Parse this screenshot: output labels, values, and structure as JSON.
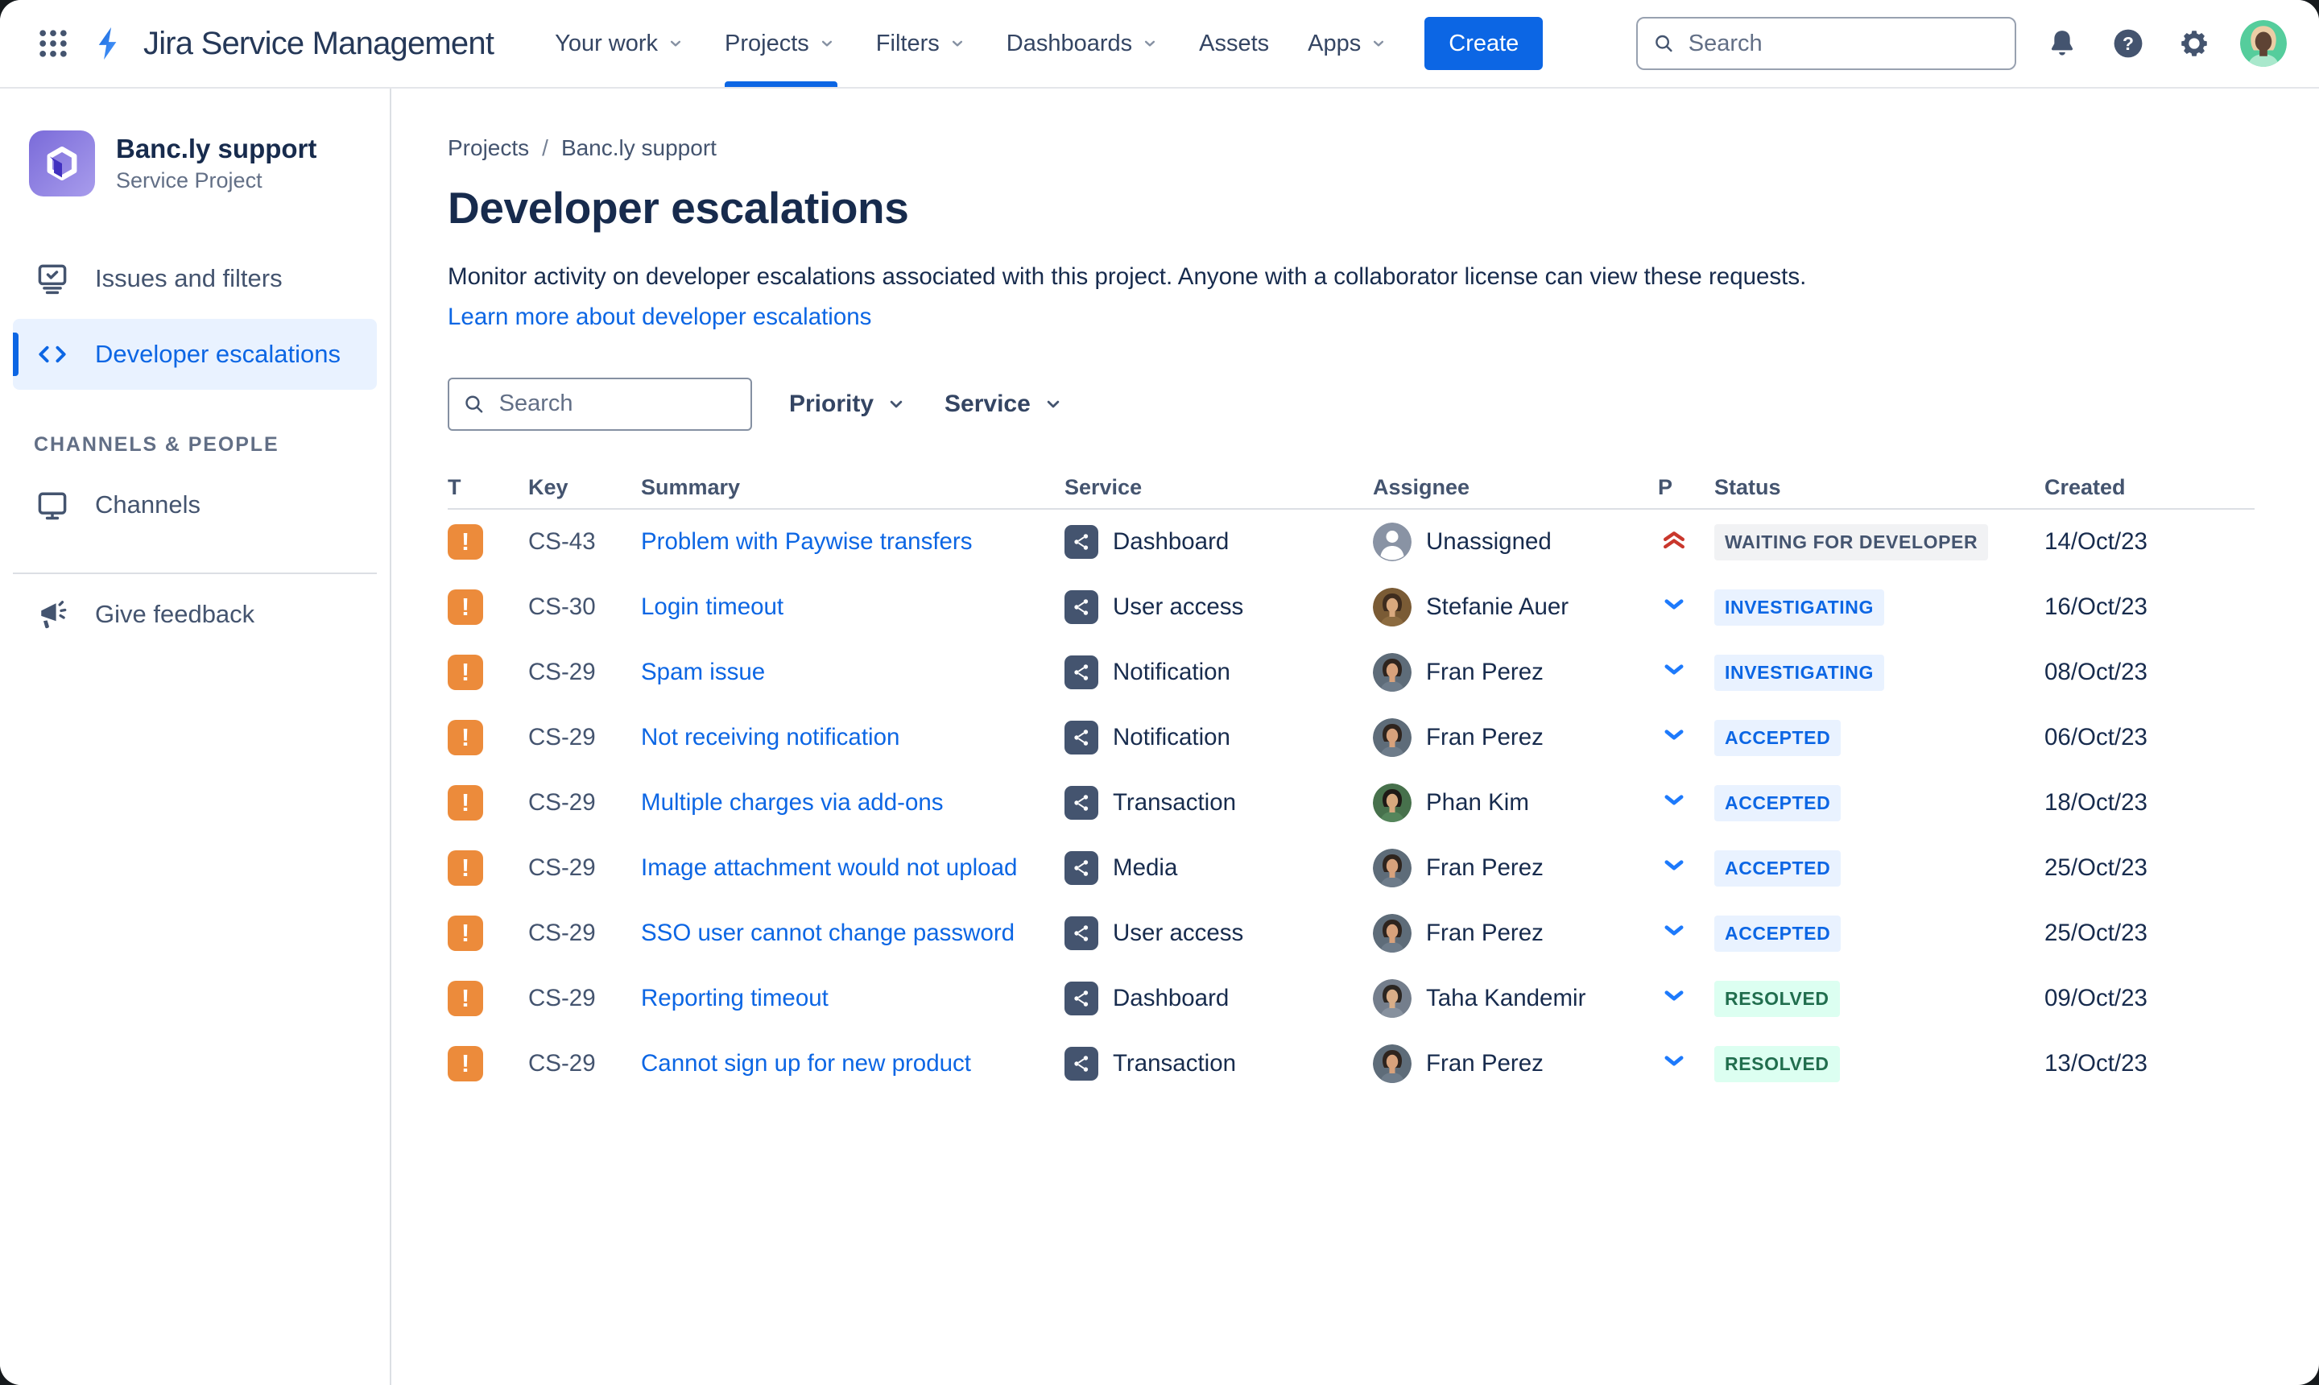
{
  "header": {
    "app_name": "Jira Service Management",
    "nav": [
      {
        "label": "Your work"
      },
      {
        "label": "Projects"
      },
      {
        "label": "Filters"
      },
      {
        "label": "Dashboards"
      },
      {
        "label": "Assets"
      },
      {
        "label": "Apps"
      }
    ],
    "create_label": "Create",
    "search_placeholder": "Search",
    "user_avatar": {
      "bg": "#55CD9C",
      "hair": "#EBCDA5",
      "skin": "#5E4334",
      "shirt": "#A9E8CC"
    }
  },
  "sidebar": {
    "project_name": "Banc.ly support",
    "project_type": "Service Project",
    "items": [
      {
        "label": "Issues and filters",
        "active": false
      },
      {
        "label": "Developer escalations",
        "active": true
      }
    ],
    "section_label": "CHANNELS & PEOPLE",
    "channels_label": "Channels",
    "feedback_label": "Give feedback"
  },
  "main": {
    "breadcrumb": [
      "Projects",
      "Banc.ly support"
    ],
    "breadcrumb_separator": "/",
    "title": "Developer escalations",
    "description": "Monitor activity on developer escalations associated with this project. Anyone with a collaborator license can view these requests.",
    "learn_more": "Learn more about developer escalations",
    "filters": {
      "search_placeholder": "Search",
      "priority_label": "Priority",
      "service_label": "Service"
    },
    "table": {
      "columns": [
        "T",
        "Key",
        "Summary",
        "Service",
        "Assignee",
        "P",
        "Status",
        "Created"
      ],
      "rows": [
        {
          "key": "CS-43",
          "summary": "Problem with Paywise transfers",
          "service": "Dashboard",
          "assignee": "Unassigned",
          "avatar": "unassigned",
          "priority": "highest",
          "status": "WAITING FOR DEVELOPER",
          "status_color": "gray",
          "created": "14/Oct/23"
        },
        {
          "key": "CS-30",
          "summary": "Login timeout",
          "service": "User access",
          "assignee": "Stefanie Auer",
          "avatar": "stefanie",
          "priority": "low",
          "status": "INVESTIGATING",
          "status_color": "blue",
          "created": "16/Oct/23"
        },
        {
          "key": "CS-29",
          "summary": "Spam issue",
          "service": "Notification",
          "assignee": "Fran Perez",
          "avatar": "fran",
          "priority": "low",
          "status": "INVESTIGATING",
          "status_color": "blue",
          "created": "08/Oct/23"
        },
        {
          "key": "CS-29",
          "summary": "Not receiving notification",
          "service": "Notification",
          "assignee": "Fran Perez",
          "avatar": "fran",
          "priority": "low",
          "status": "ACCEPTED",
          "status_color": "blue",
          "created": "06/Oct/23"
        },
        {
          "key": "CS-29",
          "summary": "Multiple charges via add-ons",
          "service": "Transaction",
          "assignee": "Phan Kim",
          "avatar": "phan",
          "priority": "low",
          "status": "ACCEPTED",
          "status_color": "blue",
          "created": "18/Oct/23"
        },
        {
          "key": "CS-29",
          "summary": "Image attachment would not upload",
          "service": "Media",
          "assignee": "Fran Perez",
          "avatar": "fran",
          "priority": "low",
          "status": "ACCEPTED",
          "status_color": "blue",
          "created": "25/Oct/23"
        },
        {
          "key": "CS-29",
          "summary": "SSO user cannot change password",
          "service": "User access",
          "assignee": "Fran Perez",
          "avatar": "fran",
          "priority": "low",
          "status": "ACCEPTED",
          "status_color": "blue",
          "created": "25/Oct/23"
        },
        {
          "key": "CS-29",
          "summary": "Reporting timeout",
          "service": "Dashboard",
          "assignee": "Taha Kandemir",
          "avatar": "taha",
          "priority": "low",
          "status": "RESOLVED",
          "status_color": "green",
          "created": "09/Oct/23"
        },
        {
          "key": "CS-29",
          "summary": "Cannot sign up for new product",
          "service": "Transaction",
          "assignee": "Fran Perez",
          "avatar": "fran",
          "priority": "low",
          "status": "RESOLVED",
          "status_color": "green",
          "created": "13/Oct/23"
        }
      ]
    }
  },
  "avatars": {
    "unassigned": {
      "bg": "#8993A4",
      "hair": "#FFFFFF",
      "skin": "#FFFFFF"
    },
    "stefanie": {
      "bg": "#7A5B35",
      "hair": "#3E2C1E",
      "skin": "#D9A97E",
      "shirt": "#8C6B40"
    },
    "fran": {
      "bg": "#5E6C79",
      "hair": "#2E241E",
      "skin": "#D8A27C",
      "shirt": "#6E7C8A"
    },
    "phan": {
      "bg": "#47714C",
      "hair": "#1F1A16",
      "skin": "#D8A97E",
      "shirt": "#55855B"
    },
    "taha": {
      "bg": "#747E8C",
      "hair": "#2B2622",
      "skin": "#D9AE88",
      "shirt": "#87919E"
    }
  },
  "colors": {
    "accent_blue": "#0C66E4",
    "selected_item_bg": "#E9F2FF",
    "incident_orange": "#EC8B3B",
    "priority_highest_red": "#C9372C",
    "priority_low_blue": "#1D7AFC",
    "service_icon_bg": "#44546F",
    "badge_gray_bg": "#F1F2F4",
    "badge_gray_text": "#44546F",
    "badge_blue_bg": "#E9F2FF",
    "badge_blue_text": "#0C66E4",
    "badge_green_bg": "#DCFFF1",
    "badge_green_text": "#216E4E"
  }
}
